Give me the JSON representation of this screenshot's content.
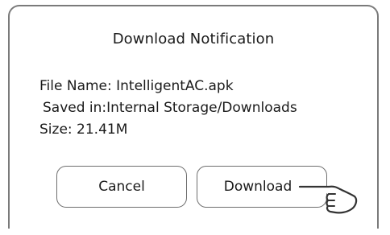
{
  "dialog": {
    "title": "Download Notification",
    "file_name_line": "File Name: IntelligentAC.apk",
    "saved_in_line": "Saved in:Internal Storage/Downloads",
    "size_line": "Size: 21.41M",
    "cancel_label": "Cancel",
    "download_label": "Download"
  },
  "icons": {
    "pointer": "tapping-hand-icon"
  }
}
